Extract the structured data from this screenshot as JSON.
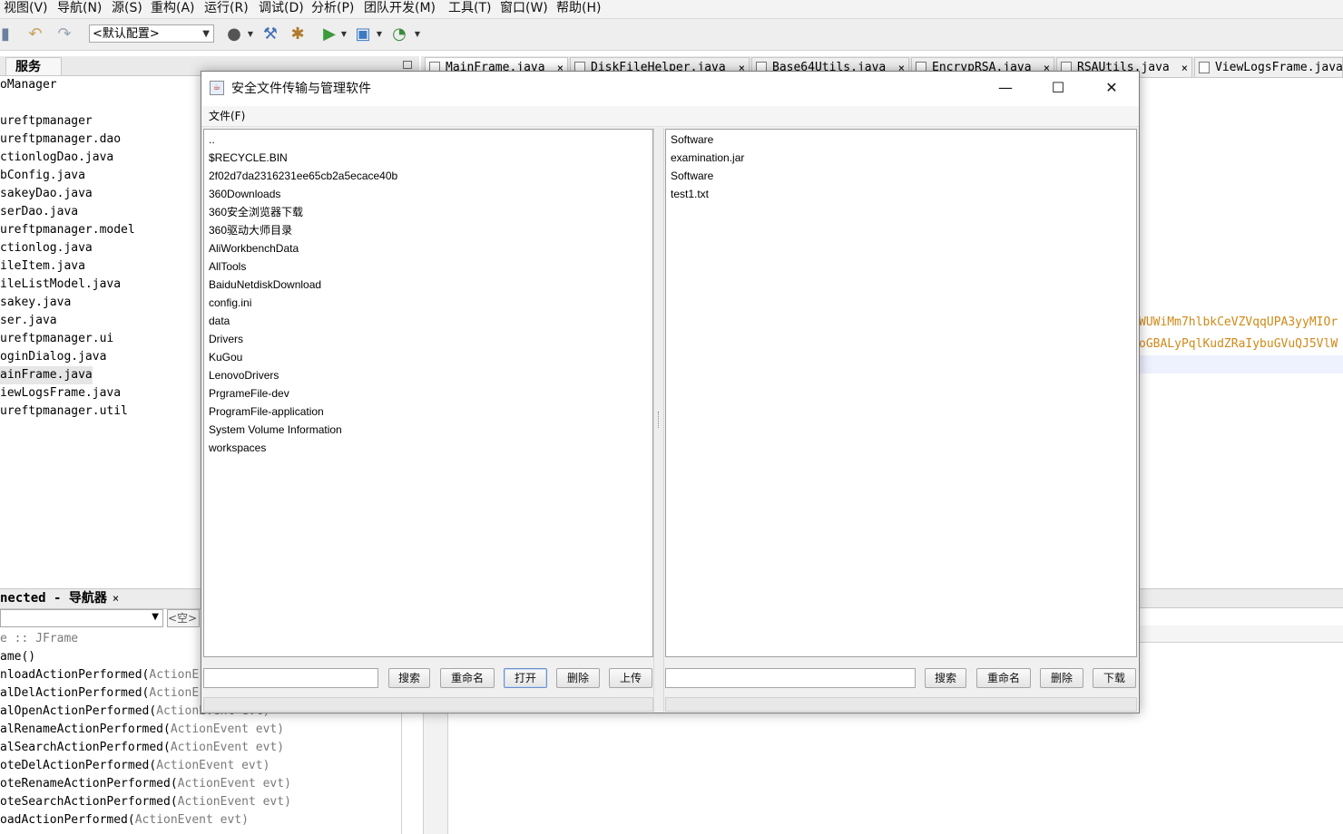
{
  "ide": {
    "menu": [
      "视图(V)",
      "导航(N)",
      "源(S)",
      "重构(A)",
      "运行(R)",
      "调试(D)",
      "分析(P)",
      "团队开发(M)",
      "工具(T)",
      "窗口(W)",
      "帮助(H)"
    ],
    "config_select": "<默认配置>",
    "services_tab": "服务",
    "tree_items": [
      "oManager",
      "",
      "ureftpmanager",
      "ureftpmanager.dao",
      "ctionlogDao.java",
      "bConfig.java",
      "sakeyDao.java",
      "serDao.java",
      "ureftpmanager.model",
      "ctionlog.java",
      "ileItem.java",
      "ileListModel.java",
      "sakey.java",
      "ser.java",
      "ureftpmanager.ui",
      "oginDialog.java",
      "ainFrame.java",
      "iewLogsFrame.java",
      "ureftpmanager.util"
    ],
    "navigator_title": "nected - 导航器",
    "navigator_close": "×",
    "navigator_filter": "<空>",
    "navigator_items": [
      {
        "name": "e :: ",
        "type": "JFrame"
      },
      {
        "name": "ame()",
        "type": ""
      },
      {
        "name": "nloadActionPerformed(",
        "type": "ActionE"
      },
      {
        "name": "alDelActionPerformed(",
        "type": "ActionE"
      },
      {
        "name": "alOpenActionPerformed(",
        "type": "ActionEvent evt)"
      },
      {
        "name": "alRenameActionPerformed(",
        "type": "ActionEvent evt)"
      },
      {
        "name": "alSearchActionPerformed(",
        "type": "ActionEvent evt)"
      },
      {
        "name": "oteDelActionPerformed(",
        "type": "ActionEvent evt)"
      },
      {
        "name": "oteRenameActionPerformed(",
        "type": "ActionEvent evt)"
      },
      {
        "name": "oteSearchActionPerformed(",
        "type": "ActionEvent evt)"
      },
      {
        "name": "oadActionPerformed(",
        "type": "ActionEvent evt)"
      }
    ],
    "editor_tabs": [
      "MainFrame.java",
      "DiskFileHelper.java",
      "Base64Utils.java",
      "EncrypRSA.java",
      "RSAUtils.java",
      "ViewLogsFrame.java"
    ],
    "tab_close": "×",
    "code_line1": "WUWiMm7hlbkCeVZVqqUPA3yyMIOr",
    "code_line2": "oGBALyPqlKudZRaIybuGVuQJ5VlW"
  },
  "dialog": {
    "title": "安全文件传输与管理软件",
    "menu_file": "文件(F)",
    "window_buttons": {
      "minimize": "—",
      "maximize": "☐",
      "close": "✕"
    },
    "local_files": [
      "..",
      "$RECYCLE.BIN",
      "2f02d7da2316231ee65cb2a5ecace40b",
      "360Downloads",
      "360安全浏览器下载",
      "360驱动大师目录",
      "AliWorkbenchData",
      "AllTools",
      "BaiduNetdiskDownload",
      "config.ini",
      "data",
      "Drivers",
      "KuGou",
      "LenovoDrivers",
      "PrgrameFile-dev",
      "ProgramFile-application",
      "System Volume Information",
      "workspaces"
    ],
    "remote_files": [
      "Software",
      "examination.jar",
      "Software",
      "test1.txt"
    ],
    "local_search_value": "",
    "remote_search_value": "",
    "local_buttons": {
      "search": "搜索",
      "rename": "重命名",
      "open": "打开",
      "delete": "删除",
      "upload": "上传"
    },
    "remote_buttons": {
      "search": "搜索",
      "rename": "重命名",
      "delete": "删除",
      "download": "下载"
    }
  }
}
